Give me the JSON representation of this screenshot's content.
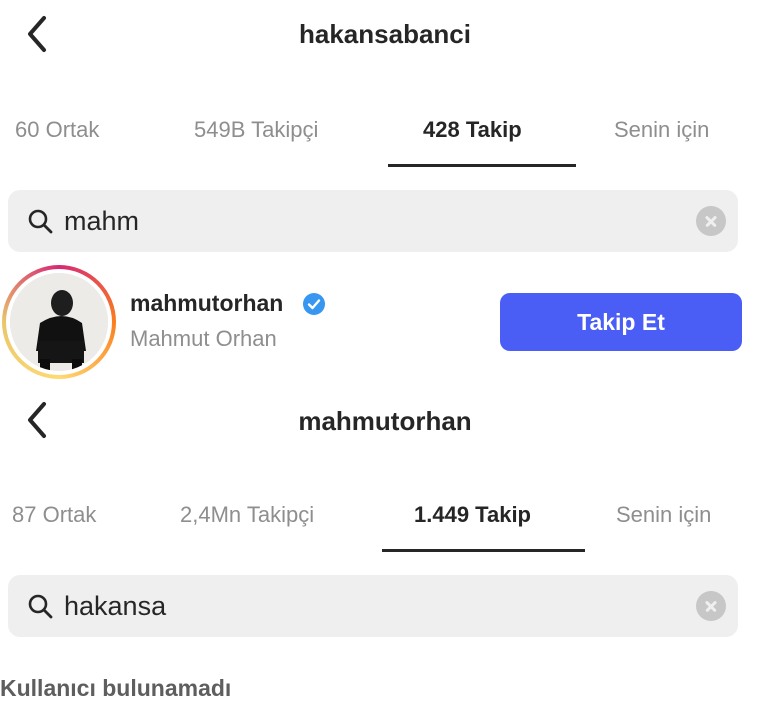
{
  "screen1": {
    "title": "hakansabanci",
    "tabs": [
      {
        "label": "60 Ortak",
        "active": false
      },
      {
        "label": "549B Takipçi",
        "active": false
      },
      {
        "label": "428 Takip",
        "active": true
      },
      {
        "label": "Senin için",
        "active": false
      }
    ],
    "search": {
      "value": "mahm",
      "icon": "search-icon"
    },
    "result": {
      "username": "mahmutorhan",
      "full_name": "Mahmut Orhan",
      "verified": true,
      "follow_label": "Takip Et"
    }
  },
  "screen2": {
    "title": "mahmutorhan",
    "tabs": [
      {
        "label": "87 Ortak",
        "active": false
      },
      {
        "label": "2,4Mn Takipçi",
        "active": false
      },
      {
        "label": "1.449 Takip",
        "active": true
      },
      {
        "label": "Senin için",
        "active": false
      }
    ],
    "search": {
      "value": "hakansa",
      "icon": "search-icon"
    },
    "empty_message": "Kullanıcı bulunamadı"
  },
  "colors": {
    "follow_button": "#4a5df5",
    "verified_badge": "#3797f0",
    "search_bg": "#efefef",
    "muted_text": "#8e8e8e"
  }
}
